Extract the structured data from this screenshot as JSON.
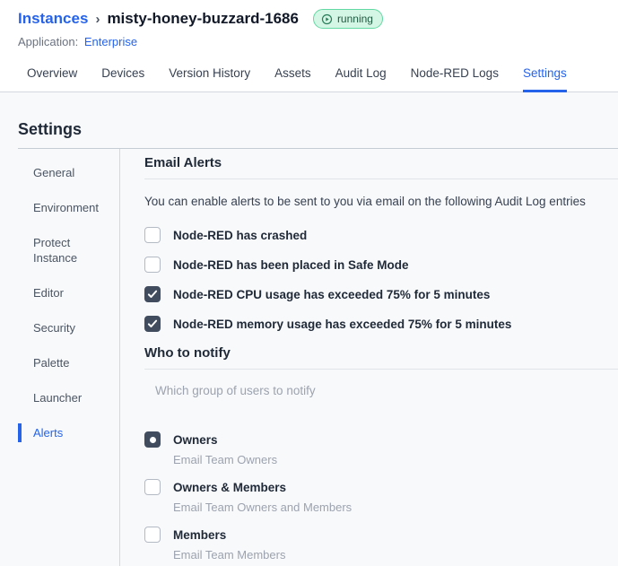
{
  "header": {
    "breadcrumb": {
      "root": "Instances",
      "separator": "›",
      "current": "misty-honey-buzzard-1686"
    },
    "status_badge": {
      "label": "running",
      "state_color": "#62d8a2"
    },
    "application": {
      "label": "Application:",
      "name": "Enterprise"
    }
  },
  "tabs": [
    {
      "label": "Overview",
      "active": false
    },
    {
      "label": "Devices",
      "active": false
    },
    {
      "label": "Version History",
      "active": false
    },
    {
      "label": "Assets",
      "active": false
    },
    {
      "label": "Audit Log",
      "active": false
    },
    {
      "label": "Node-RED Logs",
      "active": false
    },
    {
      "label": "Settings",
      "active": true
    }
  ],
  "page": {
    "title": "Settings"
  },
  "sidebar": {
    "items": [
      {
        "label": "General",
        "active": false
      },
      {
        "label": "Environment",
        "active": false
      },
      {
        "label": "Protect Instance",
        "active": false
      },
      {
        "label": "Editor",
        "active": false
      },
      {
        "label": "Security",
        "active": false
      },
      {
        "label": "Palette",
        "active": false
      },
      {
        "label": "Launcher",
        "active": false
      },
      {
        "label": "Alerts",
        "active": true
      }
    ]
  },
  "email_alerts": {
    "title": "Email Alerts",
    "description": "You can enable alerts to be sent to you via email on the following Audit Log entries",
    "options": [
      {
        "label": "Node-RED has crashed",
        "checked": false
      },
      {
        "label": "Node-RED has been placed in Safe Mode",
        "checked": false
      },
      {
        "label": "Node-RED CPU usage has exceeded 75% for 5 minutes",
        "checked": true
      },
      {
        "label": "Node-RED memory usage has exceeded 75% for 5 minutes",
        "checked": true
      }
    ]
  },
  "who_to_notify": {
    "title": "Who to notify",
    "hint": "Which group of users to notify",
    "options": [
      {
        "label": "Owners",
        "description": "Email Team Owners",
        "selected": true
      },
      {
        "label": "Owners & Members",
        "description": "Email Team Owners and Members",
        "selected": false
      },
      {
        "label": "Members",
        "description": "Email Team Members",
        "selected": false
      }
    ]
  },
  "colors": {
    "accent_blue": "#2563eb",
    "checked_fill": "#414d5f",
    "badge_bg": "#d4f6e4",
    "badge_border": "#62d8a2",
    "badge_text": "#1e5a41",
    "content_bg": "#f8f9fb"
  }
}
